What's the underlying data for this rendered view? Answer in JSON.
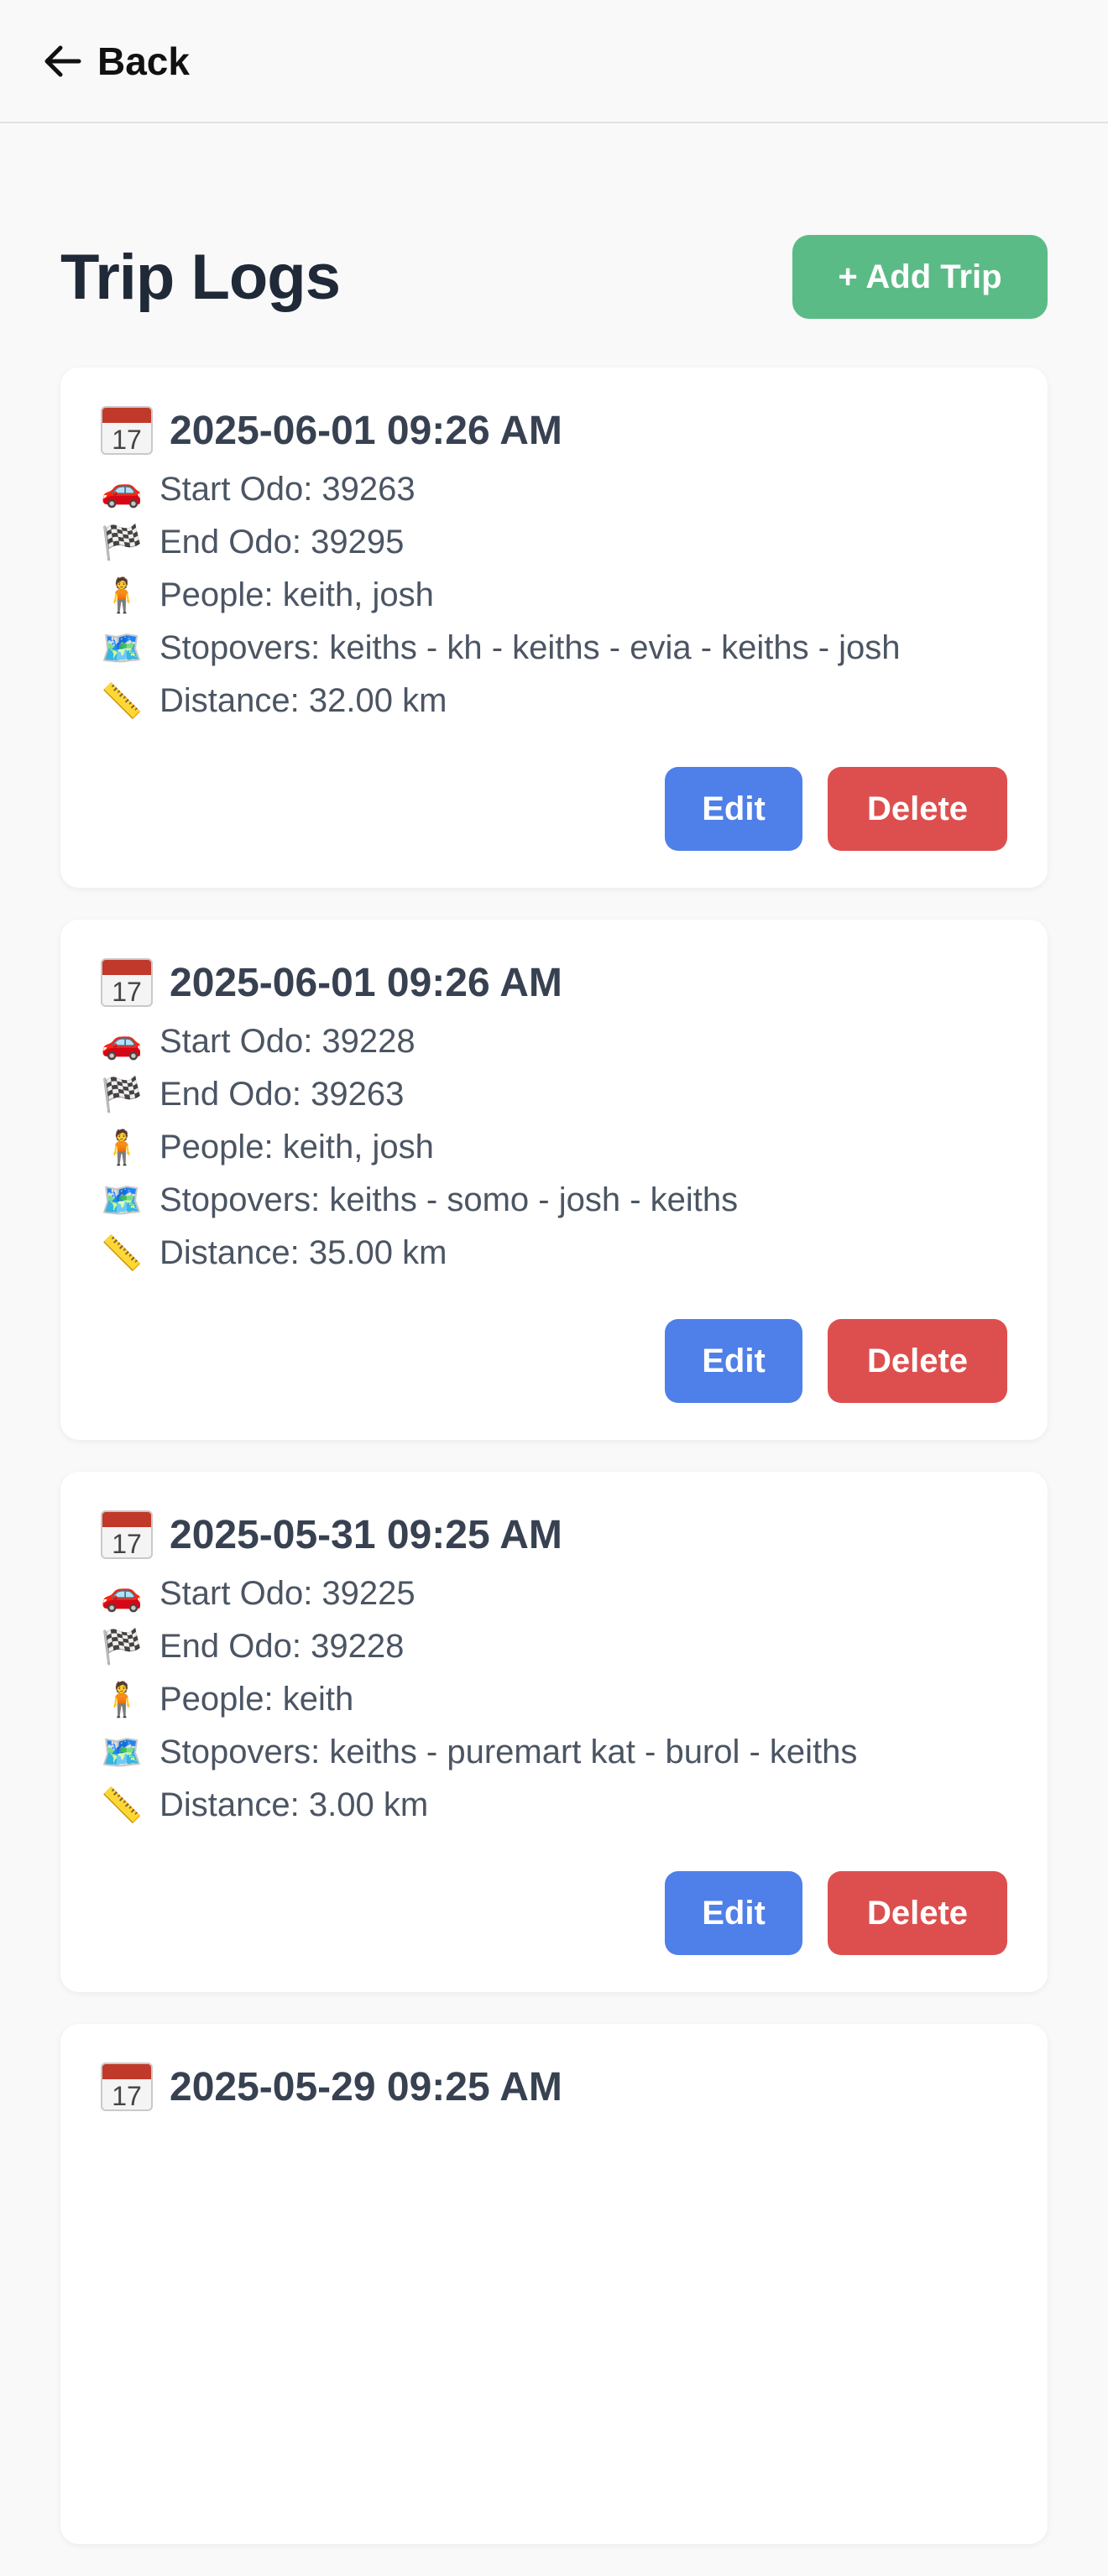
{
  "nav": {
    "back_label": "Back"
  },
  "page": {
    "title": "Trip Logs",
    "add_label": "+ Add Trip"
  },
  "icons": {
    "date": "calendar-icon",
    "start": "car-icon",
    "end": "checkered-flag-icon",
    "people": "person-icon",
    "stopovers": "map-icon",
    "distance": "ruler-icon"
  },
  "colors": {
    "add": "#5bbb86",
    "edit": "#4f7fe8",
    "delete": "#dd4f4f"
  },
  "trips": [
    {
      "date": "2025-06-01 09:26 AM",
      "start": "Start Odo: 39263",
      "end": "End Odo: 39295",
      "people": "People: keith, josh",
      "stopovers": "Stopovers: keiths - kh - keiths - evia - keiths - josh",
      "distance": "Distance: 32.00 km",
      "edit_label": "Edit",
      "delete_label": "Delete"
    },
    {
      "date": "2025-06-01 09:26 AM",
      "start": "Start Odo: 39228",
      "end": "End Odo: 39263",
      "people": "People: keith, josh",
      "stopovers": "Stopovers: keiths - somo - josh - keiths",
      "distance": "Distance: 35.00 km",
      "edit_label": "Edit",
      "delete_label": "Delete"
    },
    {
      "date": "2025-05-31 09:25 AM",
      "start": "Start Odo: 39225",
      "end": "End Odo: 39228",
      "people": "People: keith",
      "stopovers": "Stopovers: keiths - puremart kat - burol - keiths",
      "distance": "Distance: 3.00 km",
      "edit_label": "Edit",
      "delete_label": "Delete"
    },
    {
      "date": "2025-05-29 09:25 AM"
    }
  ]
}
